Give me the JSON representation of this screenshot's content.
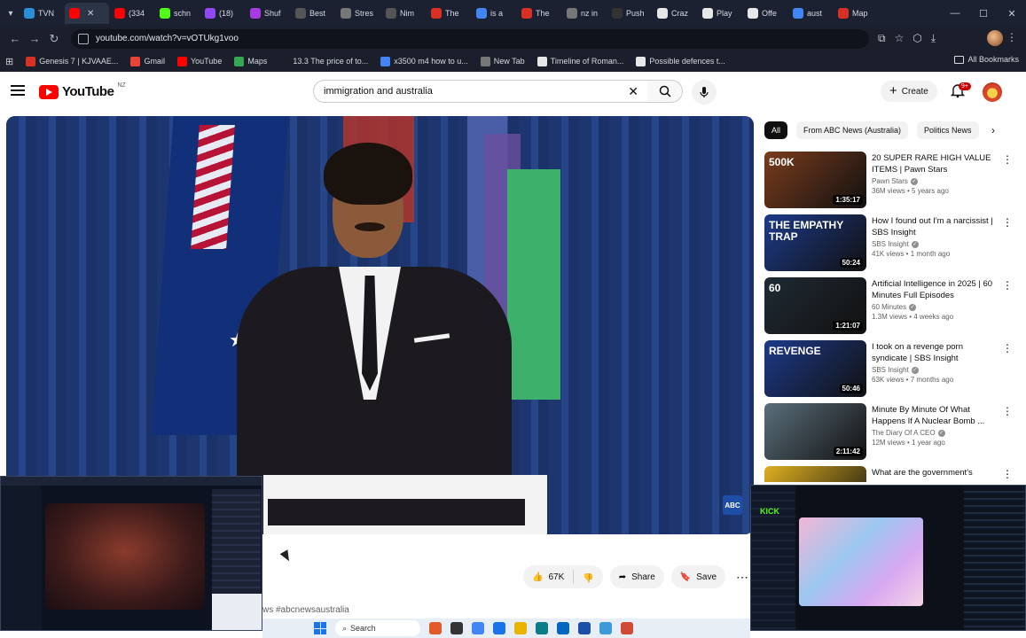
{
  "browser": {
    "tabs": [
      {
        "label": "TVN",
        "color": "#2b8cd8"
      },
      {
        "label": "",
        "color": "#ff0000",
        "active": true
      },
      {
        "label": "(334",
        "color": "#ff0000"
      },
      {
        "label": "schn",
        "color": "#53fc18"
      },
      {
        "label": "(18)",
        "color": "#9146ff"
      },
      {
        "label": "Shuf",
        "color": "#a53be0"
      },
      {
        "label": "Best",
        "color": "#555555"
      },
      {
        "label": "Stres",
        "color": "#777777"
      },
      {
        "label": "Nim",
        "color": "#555555"
      },
      {
        "label": "The",
        "color": "#d93025"
      },
      {
        "label": "is a",
        "color": "#4285f4"
      },
      {
        "label": "The",
        "color": "#d93025"
      },
      {
        "label": "nz in",
        "color": "#777777"
      },
      {
        "label": "Push",
        "color": "#333333"
      },
      {
        "label": "Craz",
        "color": "#e7e7e7"
      },
      {
        "label": "Play",
        "color": "#e7e7e7"
      },
      {
        "label": "Offe",
        "color": "#e7e7e7"
      },
      {
        "label": "aust",
        "color": "#4285f4"
      },
      {
        "label": "Map",
        "color": "#d93025"
      }
    ],
    "url": "youtube.com/watch?v=vOTUkg1voo",
    "bookmarks": [
      {
        "label": "Genesis 7 | KJVAAE...",
        "color": "#d93025"
      },
      {
        "label": "Gmail",
        "color": "#ea4335"
      },
      {
        "label": "YouTube",
        "color": "#ff0000"
      },
      {
        "label": "Maps",
        "color": "#34a853"
      },
      {
        "label": "13.3 The price of to...",
        "color": "#1a1f2b"
      },
      {
        "label": "x3500 m4 how to u...",
        "color": "#4285f4"
      },
      {
        "label": "New Tab",
        "color": "#777777"
      },
      {
        "label": "Timeline of Roman...",
        "color": "#e7e7e7"
      },
      {
        "label": "Possible defences t...",
        "color": "#e7e7e7"
      }
    ],
    "all_bookmarks": "All Bookmarks"
  },
  "youtube": {
    "logo_text": "YouTube",
    "country": "NZ",
    "search_value": "immigration and australia",
    "create_label": "Create",
    "notif_count": "9+",
    "video_badge": "ABC",
    "actions": {
      "likes": "67K",
      "share": "Share",
      "save": "Save"
    },
    "hashtag": "ws #abcnewsaustralia",
    "chips": [
      "All",
      "From ABC News (Australia)",
      "Politics News"
    ],
    "recommendations": [
      {
        "title": "20 SUPER RARE HIGH VALUE ITEMS | Pawn Stars",
        "channel": "Pawn Stars",
        "meta": "36M views • 5 years ago",
        "duration": "1:35:17",
        "thumb_text": "500K",
        "thumb_color": "#7a3b1d"
      },
      {
        "title": "How I found out I'm a narcissist | SBS Insight",
        "channel": "SBS Insight",
        "meta": "41K views • 1 month ago",
        "duration": "50:24",
        "thumb_text": "THE EMPATHY TRAP",
        "thumb_color": "#1d3a8a"
      },
      {
        "title": "Artificial Intelligence in 2025 | 60 Minutes Full Episodes",
        "channel": "60 Minutes",
        "meta": "1.3M views • 4 weeks ago",
        "duration": "1:21:07",
        "thumb_text": "60",
        "thumb_color": "#1f2a33"
      },
      {
        "title": "I took on a revenge porn syndicate | SBS Insight",
        "channel": "SBS Insight",
        "meta": "63K views • 7 months ago",
        "duration": "50:46",
        "thumb_text": "REVENGE",
        "thumb_color": "#1d3a8a"
      },
      {
        "title": "Minute By Minute Of What Happens If A Nuclear Bomb ...",
        "channel": "The Diary Of A CEO",
        "meta": "12M views • 1 year ago",
        "duration": "2:11:42",
        "thumb_text": "",
        "thumb_color": "#5a6e7a"
      },
      {
        "title": "What are the government's",
        "channel": "",
        "meta": "",
        "duration": "",
        "thumb_text": "",
        "thumb_color": "#e0b020"
      }
    ]
  },
  "overlay_right": {
    "logo": "KICK"
  },
  "taskbar": {
    "search_label": "Search",
    "icons": [
      "#e05a2a",
      "#333333",
      "#4285f4",
      "#1a73e8",
      "#e8b400",
      "#0a7c8a",
      "#0067c0",
      "#1e4fa8",
      "#3c9bd6",
      "#d04a35"
    ]
  }
}
